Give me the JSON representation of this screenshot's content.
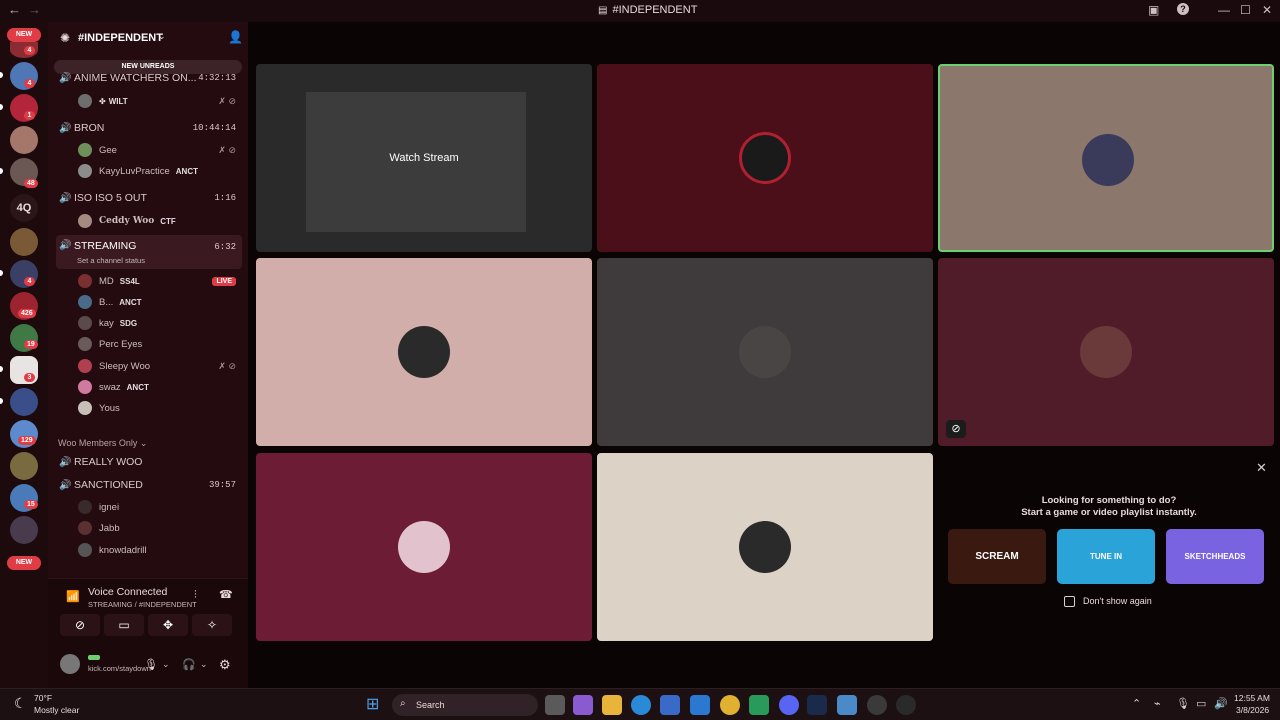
{
  "window": {
    "title": "#INDEPENDENT"
  },
  "rail": {
    "new_top": "NEW",
    "new_bottom": "NEW",
    "server_text": "4Q",
    "badges": [
      "4",
      "4",
      "1",
      "48",
      "4",
      "426",
      "19",
      "3",
      "129",
      "15"
    ]
  },
  "server": {
    "name": "#INDEPENDENT",
    "new_unreads": "NEW UNREADS"
  },
  "channels": [
    {
      "name": "ANIME WATCHERS ON...",
      "time": "4:32:13",
      "users": [
        {
          "name": "",
          "tag": "WILT"
        }
      ]
    },
    {
      "name": "BRON",
      "time": "10:44:14",
      "users": [
        {
          "name": "Gee"
        },
        {
          "name": "KayyLuvPractice",
          "tag": "ANCT"
        }
      ]
    },
    {
      "name": "ISO ISO 5 OUT",
      "time": "1:16",
      "users": [
        {
          "name": "Ceddy Woo",
          "tag": "CTF"
        }
      ]
    },
    {
      "name": "STREAMING",
      "time": "6:32",
      "status": "Set a channel status",
      "live": "LIVE",
      "users": [
        {
          "name": "MD",
          "tag": "SS4L"
        },
        {
          "name": "B...",
          "tag": "ANCT"
        },
        {
          "name": "kay",
          "tag": "SDG"
        },
        {
          "name": "Perc Eyes"
        },
        {
          "name": "Sleepy Woo"
        },
        {
          "name": "swaz",
          "tag": "ANCT"
        },
        {
          "name": "Yous"
        }
      ]
    }
  ],
  "category": "Woo Members Only",
  "channels2": [
    {
      "name": "REALLY WOO"
    },
    {
      "name": "SANCTIONED",
      "time": "39:57",
      "users": [
        {
          "name": "ignei"
        },
        {
          "name": "Jabb"
        },
        {
          "name": "knowdadrill"
        }
      ]
    }
  ],
  "voice": {
    "status": "Voice Connected",
    "location": "STREAMING / #INDEPENDENT",
    "user_status": "kick.com/staydown"
  },
  "stage": {
    "watch": "Watch Stream"
  },
  "activity": {
    "line1": "Looking for something to do?",
    "line2": "Start a game or video playlist instantly.",
    "cards": [
      "SCREAM",
      "TUNE IN",
      "SKETCHHEADS"
    ],
    "checkbox": "Don't show again"
  },
  "taskbar": {
    "temp": "70°F",
    "weather": "Mostly clear",
    "search": "Search",
    "time": "12:55 AM",
    "date": "3/8/2026"
  },
  "colors": {
    "accent": "#e03c46",
    "speaking": "#6fcf6f"
  }
}
